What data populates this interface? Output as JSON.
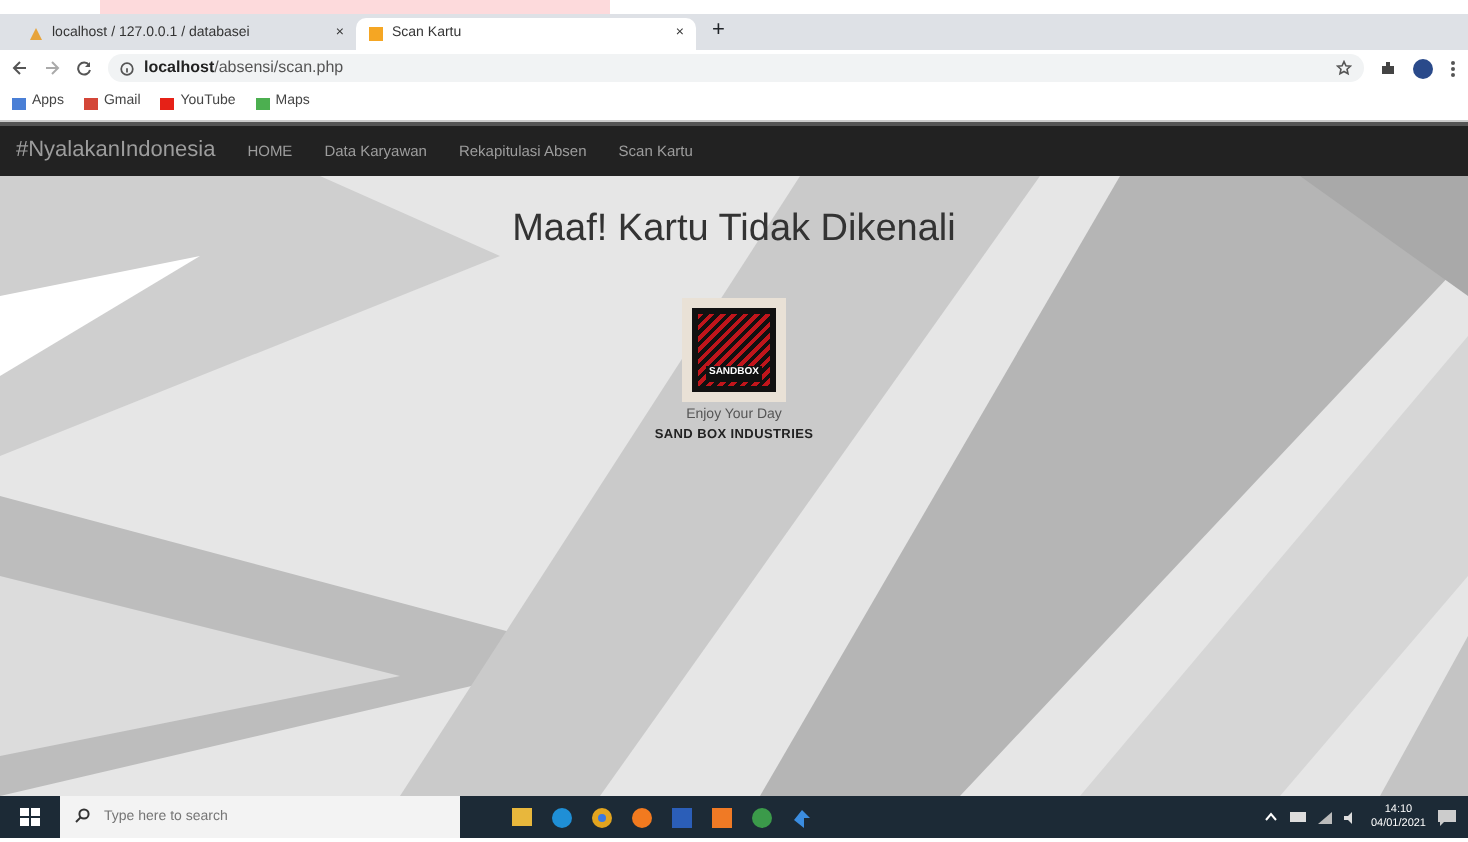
{
  "browser": {
    "tabs": [
      {
        "title": "localhost / 127.0.0.1 / databasei",
        "close": "×",
        "selected": false
      },
      {
        "title": "Scan Kartu",
        "close": "×",
        "selected": true
      }
    ],
    "new_tab": "+",
    "address": {
      "host": "localhost",
      "path": "/absensi/scan.php"
    },
    "bookmarks": [
      "Apps",
      "Gmail",
      "YouTube",
      "Maps"
    ]
  },
  "navbar": {
    "brand": "#NyalakanIndonesia",
    "links": [
      "HOME",
      "Data Karyawan",
      "Rekapitulasi Absen",
      "Scan Kartu"
    ]
  },
  "content": {
    "heading": "Maaf! Kartu Tidak Dikenali",
    "logo_text": "SANDBOX",
    "tagline": "Enjoy Your Day",
    "company": "SAND BOX INDUSTRIES"
  },
  "taskbar": {
    "search": {
      "placeholder": "Type here to search"
    },
    "time": "14:10",
    "date": "04/01/2021"
  }
}
